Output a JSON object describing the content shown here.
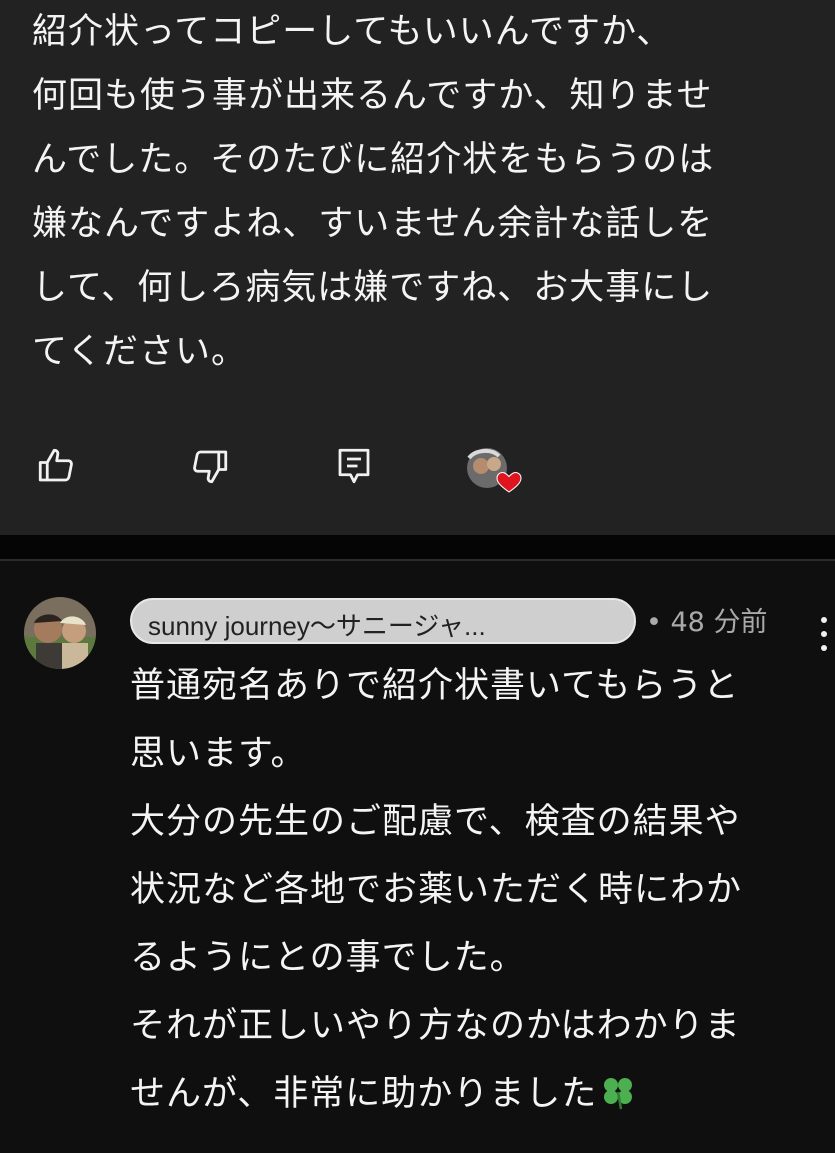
{
  "previous_comment": {
    "text": "紹介状ってコピーしてもいいんですか、\n何回も使う事が出来るんですか、知りませ\nんでした。そのたびに紹介状をもらうのは\n嫌なんですよね、すいません余計な話しを\nして、何しろ病気は嫌ですね、お大事にし\nてください。",
    "actions": {
      "like_icon": "thumbs-up-icon",
      "dislike_icon": "thumbs-down-icon",
      "reply_icon": "reply-comment-icon",
      "creator_heart_icon": "creator-heart-icon"
    }
  },
  "reply_comment": {
    "author": "sunny journey〜サニージャ...",
    "timestamp": "• 48 分前",
    "text": "普通宛名ありで紹介状書いてもらうと\n思います。\n大分の先生のご配慮で、検査の結果や\n状況など各地でお薬いただく時にわか\nるようにとの事でした。\nそれが正しいやり方なのかはわかりま\nせんが、非常に助かりました",
    "emoji": "four-leaf-clover"
  },
  "colors": {
    "top_card_bg": "#222222",
    "page_bg": "#0f0f0f",
    "heart": "#e0141e",
    "clover": "#4caf50"
  }
}
